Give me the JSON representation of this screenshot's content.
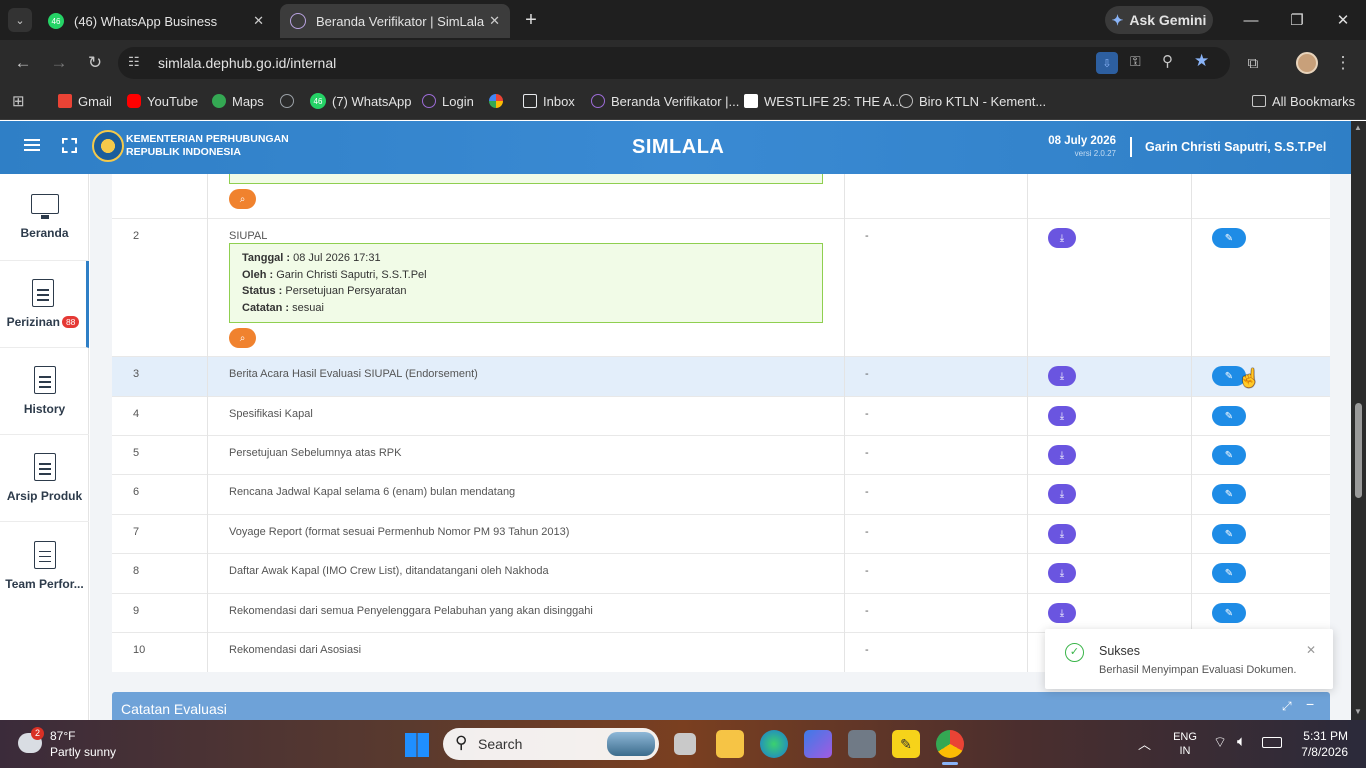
{
  "browser": {
    "tabs": [
      {
        "title": "(46) WhatsApp Business",
        "badge": "46",
        "icon": "whatsapp-icon",
        "active": false
      },
      {
        "title": "Beranda Verifikator | SimLala",
        "icon": "globe-icon",
        "active": true
      }
    ],
    "new_tab": "+",
    "ask_gemini": "Ask Gemini",
    "url": "simlala.dephub.go.id/internal",
    "bookmarks": [
      {
        "label": "Gmail",
        "icon": "gmail-icon",
        "color": "#ea4335"
      },
      {
        "label": "YouTube",
        "icon": "youtube-icon",
        "color": "#ff0000"
      },
      {
        "label": "Maps",
        "icon": "maps-icon",
        "color": "#34a853"
      },
      {
        "label": "",
        "icon": "globe-icon",
        "color": "#9aa0a6"
      },
      {
        "label": "(7) WhatsApp",
        "icon": "whatsapp-icon",
        "color": "#25d366",
        "badge": "46"
      },
      {
        "label": "Login",
        "icon": "globe-icon",
        "color": "#9c6bd6"
      },
      {
        "label": "",
        "icon": "pinwheel-icon",
        "color": "#f4b400"
      },
      {
        "label": "Inbox",
        "icon": "inbox-icon",
        "color": "#e8eaed"
      },
      {
        "label": "Beranda Verifikator |...",
        "icon": "globe-icon",
        "color": "#9c6bd6"
      },
      {
        "label": "WESTLIFE 25: THE A...",
        "icon": "letter-l-icon",
        "color": "#ffffff"
      },
      {
        "label": "Biro KTLN - Kement...",
        "icon": "globe-icon",
        "color": "#bdbdbd"
      }
    ],
    "all_bookmarks": "All Bookmarks"
  },
  "app": {
    "org_line1": "KEMENTERIAN PERHUBUNGAN",
    "org_line2": "REPUBLIK INDONESIA",
    "title": "SIMLALA",
    "date": "08 July 2026",
    "version": "versi 2.0.27",
    "user": "Garin Christi Saputri, S.S.T.Pel"
  },
  "sidebar": {
    "items": [
      {
        "label": "Beranda",
        "icon": "monitor-icon"
      },
      {
        "label": "Perizinan",
        "icon": "document-icon",
        "badge": "88"
      },
      {
        "label": "History",
        "icon": "document-icon"
      },
      {
        "label": "Arsip Produk",
        "icon": "document-icon"
      },
      {
        "label": "Team Perfor...",
        "icon": "document-icon"
      }
    ]
  },
  "table": {
    "rows": [
      {
        "no": "2",
        "doc": "SIUPAL",
        "keterangan": "-",
        "note": {
          "tanggal_label": "Tanggal :",
          "tanggal": "08 Jul 2026 17:31",
          "oleh_label": "Oleh :",
          "oleh": "Garin Christi Saputri, S.S.T.Pel",
          "status_label": "Status :",
          "status": "Persetujuan Persyaratan",
          "catatan_label": "Catatan :",
          "catatan": "sesuai"
        }
      },
      {
        "no": "3",
        "doc": "Berita Acara Hasil Evaluasi SIUPAL (Endorsement)",
        "keterangan": "-"
      },
      {
        "no": "4",
        "doc": "Spesifikasi Kapal",
        "keterangan": "-"
      },
      {
        "no": "5",
        "doc": "Persetujuan Sebelumnya atas RPK",
        "keterangan": "-"
      },
      {
        "no": "6",
        "doc": "Rencana Jadwal Kapal selama 6 (enam) bulan mendatang",
        "keterangan": "-"
      },
      {
        "no": "7",
        "doc": "Voyage Report (format sesuai Permenhub Nomor PM 93 Tahun 2013)",
        "keterangan": "-"
      },
      {
        "no": "8",
        "doc": "Daftar Awak Kapal (IMO Crew List), ditandatangani oleh Nakhoda",
        "keterangan": "-"
      },
      {
        "no": "9",
        "doc": "Rekomendasi dari semua Penyelenggara Pelabuhan yang akan disinggahi",
        "keterangan": "-"
      },
      {
        "no": "10",
        "doc": "Rekomendasi dari Asosiasi",
        "keterangan": "-"
      }
    ]
  },
  "catatan_panel": {
    "title": "Catatan Evaluasi"
  },
  "toast": {
    "title": "Sukses",
    "message": "Berhasil Menyimpan Evaluasi Dokumen."
  },
  "taskbar": {
    "weather_badge": "2",
    "temperature": "87°F",
    "weather": "Partly sunny",
    "search_placeholder": "Search",
    "lang": "ENG",
    "region": "IN",
    "time": "5:31 PM",
    "date": "7/8/2026"
  }
}
